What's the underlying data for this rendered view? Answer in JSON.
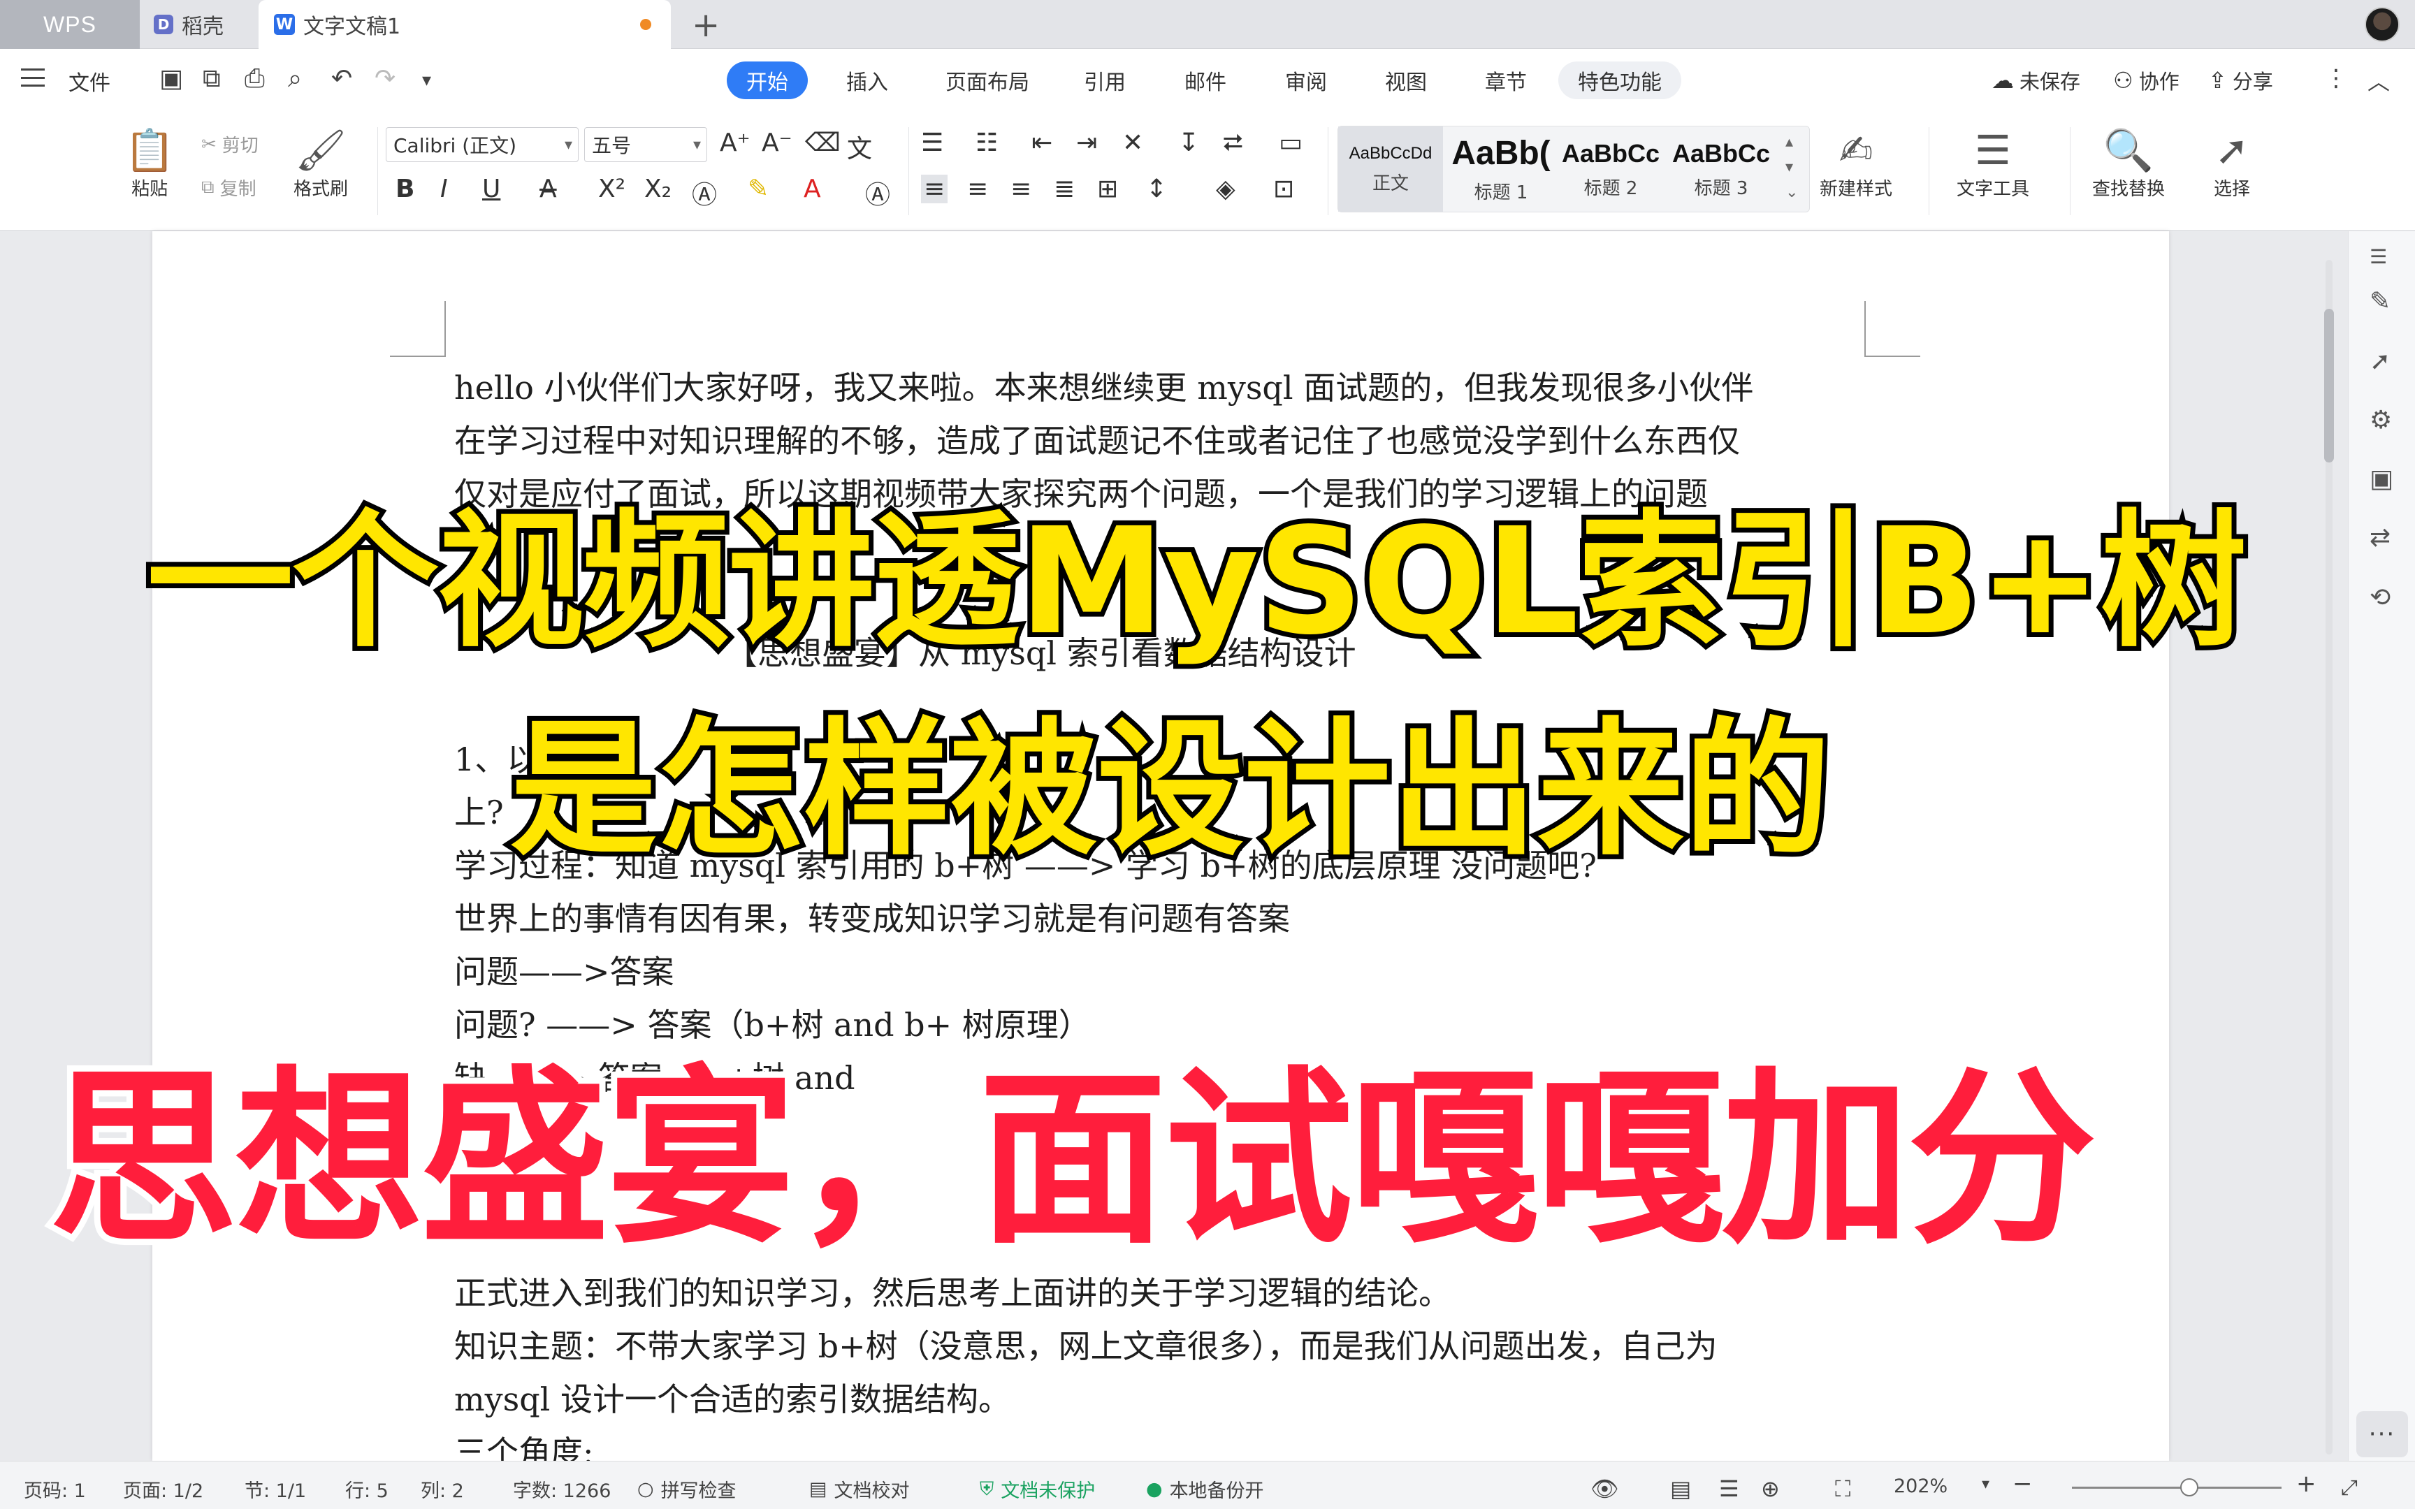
{
  "tabs": {
    "wps": "WPS",
    "daoke": "稻壳",
    "document": "文字文稿1",
    "add": "+"
  },
  "menu": {
    "file": "文件",
    "tabs": [
      "开始",
      "插入",
      "页面布局",
      "引用",
      "邮件",
      "审阅",
      "视图",
      "章节",
      "特色功能"
    ],
    "unsaved": "未保存",
    "collab": "协作",
    "share": "分享"
  },
  "ribbon": {
    "paste": "粘贴",
    "cut": "剪切",
    "copy": "复制",
    "format_painter": "格式刷",
    "font_name": "Calibri (正文)",
    "font_size": "五号",
    "styles": [
      {
        "preview": "AaBbCcDd",
        "label": "正文"
      },
      {
        "preview": "AaBb(",
        "label": "标题 1"
      },
      {
        "preview": "AaBbCc",
        "label": "标题 2"
      },
      {
        "preview": "AaBbCc",
        "label": "标题 3"
      }
    ],
    "new_style": "新建样式",
    "text_tools": "文字工具",
    "find_replace": "查找替换",
    "select": "选择"
  },
  "document": {
    "lines": [
      "hello 小伙伴们大家好呀，我又来啦。本来想继续更 mysql 面试题的，但我发现很多小伙伴",
      "在学习过程中对知识理解的不够，造成了面试题记不住或者记住了也感觉没学到什么东西仅",
      "仅对是应付了面试，所以这期视频带大家探究两个问题，一个是我们的学习逻辑上的问题",
      "【思想盛宴】从 mysql 索引看数据结构设计",
      "1、以",
      "上?",
      "学习过程：知道 mysql 索引用的 b+树 ——>  学习 b+树的底层原理        没问题吧?",
      "世界上的事情有因有果，转变成知识学习就是有问题有答案",
      "问题——>答案",
      "问题? ——>  答案（b+树  and b+  树原理）",
      "缺  ——>  答案  （b+树  and",
      "正式进入到我们的知识学习，然后思考上面讲的关于学习逻辑的结论。",
      "知识主题：不带大家学习 b+树（没意思，网上文章很多），而是我们从问题出发，自己为",
      "mysql 设计一个合适的索引数据结构。",
      "三个角度:"
    ]
  },
  "overlay": {
    "line1": "一个视频讲透MySQL索引B+树",
    "line2": "是怎样被设计出来的",
    "line3": "思想盛宴，面试嘎嘎加分"
  },
  "status": {
    "page_no": "页码: 1",
    "pages": "页面: 1/2",
    "section": "节: 1/1",
    "row": "行: 5",
    "col": "列: 2",
    "words": "字数: 1266",
    "spell": "拼写检查",
    "proof": "文档校对",
    "unprotected": "文档未保护",
    "backup": "本地备份开",
    "zoom": "202%"
  },
  "colors": {
    "accent": "#2f7cf6",
    "caption_yellow": "#ffe600",
    "caption_red": "#ff1e3c"
  }
}
